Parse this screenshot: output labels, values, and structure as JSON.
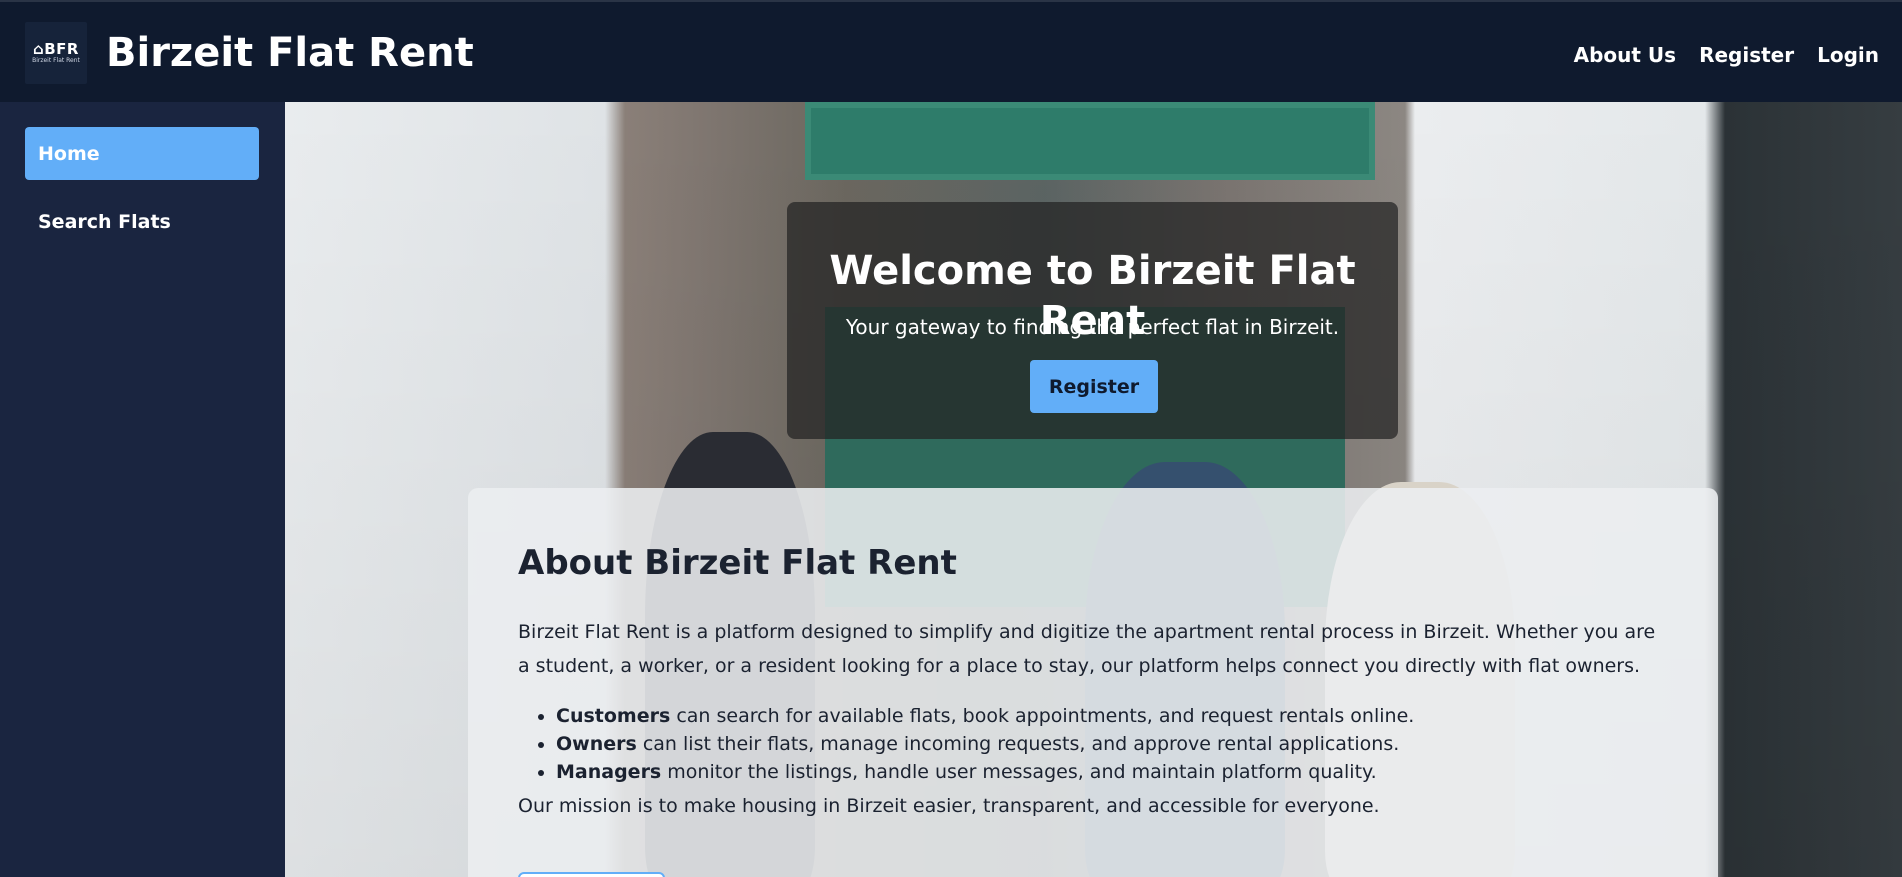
{
  "header": {
    "logo_main": "⌂BFR",
    "logo_sub": "Birzeit Flat Rent",
    "title": "Birzeit Flat Rent",
    "nav": [
      "About Us",
      "Register",
      "Login"
    ]
  },
  "sidebar": {
    "items": [
      {
        "label": "Home",
        "active": true
      },
      {
        "label": "Search Flats",
        "active": false
      }
    ]
  },
  "hero": {
    "title": "Welcome to Birzeit Flat Rent",
    "subtitle": "Your gateway to finding the perfect flat in Birzeit.",
    "button_label": "Register"
  },
  "about": {
    "title": "About Birzeit Flat Rent",
    "paragraph": "Birzeit Flat Rent is a platform designed to simplify and digitize the apartment rental process in Birzeit. Whether you are a student, a worker, or a resident looking for a place to stay, our platform helps connect you directly with flat owners.",
    "list": [
      {
        "bold": "Customers",
        "text": " can search for available flats, book appointments, and request rentals online."
      },
      {
        "bold": "Owners",
        "text": " can list their flats, manage incoming requests, and approve rental applications."
      },
      {
        "bold": "Managers",
        "text": " monitor the listings, handle user messages, and maintain platform quality."
      }
    ],
    "mission": "Our mission is to make housing in Birzeit easier, transparent, and accessible for everyone."
  },
  "colors": {
    "header_bg": "#0f1a2e",
    "sidebar_bg": "#1a2540",
    "accent": "#62aef8"
  }
}
